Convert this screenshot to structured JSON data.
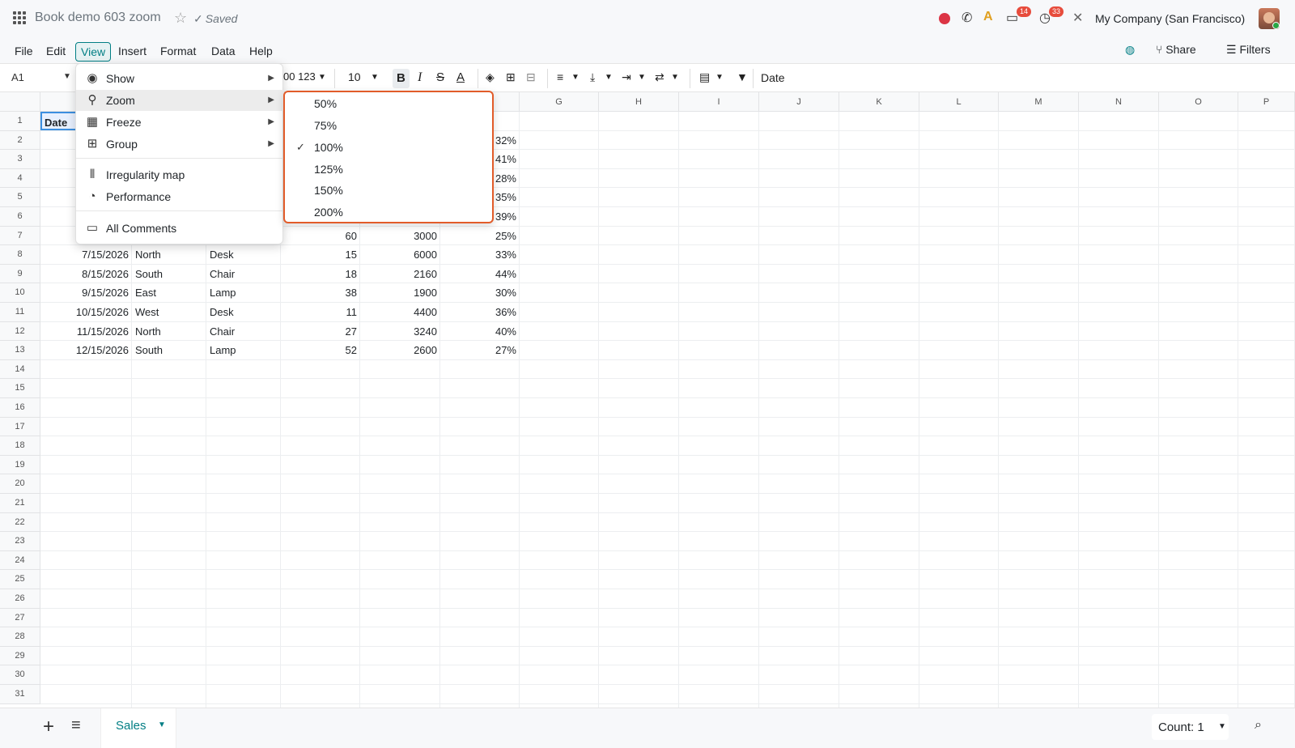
{
  "app": {
    "doc_title": "Book demo 603 zoom",
    "saved_label": "Saved",
    "company": "My Company (San Francisco)",
    "badges": {
      "messages": "14",
      "activities": "33"
    }
  },
  "menubar": {
    "items": [
      "File",
      "Edit",
      "View",
      "Insert",
      "Format",
      "Data",
      "Help"
    ],
    "share": "Share",
    "filters": "Filters"
  },
  "toolbar": {
    "cell_ref": "A1",
    "number_format": "00 123",
    "font_size": "10",
    "formula": "Date"
  },
  "view_menu": {
    "items": [
      {
        "label": "Show",
        "icon": "eye-icon"
      },
      {
        "label": "Zoom",
        "icon": "zoom-icon"
      },
      {
        "label": "Freeze",
        "icon": "freeze-icon"
      },
      {
        "label": "Group",
        "icon": "group-icon"
      },
      {
        "label": "Irregularity map",
        "icon": "irregularity-icon"
      },
      {
        "label": "Performance",
        "icon": "performance-icon"
      },
      {
        "label": "All Comments",
        "icon": "comment-icon"
      }
    ]
  },
  "zoom_menu": {
    "options": [
      "50%",
      "75%",
      "100%",
      "125%",
      "150%",
      "200%"
    ],
    "selected": "100%"
  },
  "sheet": {
    "columns": [
      "G",
      "H",
      "I",
      "J",
      "K",
      "L",
      "M",
      "N",
      "O",
      "P"
    ],
    "a1_value": "Date",
    "visible_pct_col_rows2_6": [
      "32%",
      "41%",
      "28%",
      "35%",
      "39%"
    ],
    "row7": {
      "qty": "60",
      "revenue": "3000",
      "pct": "25%"
    },
    "rows": [
      {
        "date": "7/15/2026",
        "region": "North",
        "product": "Desk",
        "qty": "15",
        "revenue": "6000",
        "pct": "33%"
      },
      {
        "date": "8/15/2026",
        "region": "South",
        "product": "Chair",
        "qty": "18",
        "revenue": "2160",
        "pct": "44%"
      },
      {
        "date": "9/15/2026",
        "region": "East",
        "product": "Lamp",
        "qty": "38",
        "revenue": "1900",
        "pct": "30%"
      },
      {
        "date": "10/15/2026",
        "region": "West",
        "product": "Desk",
        "qty": "11",
        "revenue": "4400",
        "pct": "36%"
      },
      {
        "date": "11/15/2026",
        "region": "North",
        "product": "Chair",
        "qty": "27",
        "revenue": "3240",
        "pct": "40%"
      },
      {
        "date": "12/15/2026",
        "region": "South",
        "product": "Lamp",
        "qty": "52",
        "revenue": "2600",
        "pct": "27%"
      }
    ],
    "row_count": 31
  },
  "bottom": {
    "sheet_tab": "Sales",
    "count": "Count: 1"
  },
  "colors": {
    "accent": "#017e84",
    "highlight_border": "#e25c2a",
    "record": "#dc3545"
  }
}
